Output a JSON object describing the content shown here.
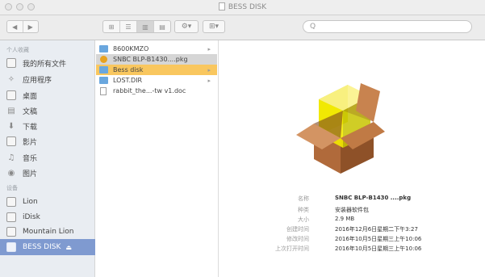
{
  "window": {
    "title": "BESS DISK"
  },
  "search": {
    "placeholder": "Q"
  },
  "toolbar": {
    "back": "◀",
    "forward": "▶",
    "view_icon": "⊞",
    "list_icon": "☰",
    "column_icon": "▥",
    "coverflow_icon": "▤",
    "action_icon": "⚙▾",
    "arrange_icon": "⊞▾"
  },
  "sidebar": {
    "favorites_header": "个人收藏",
    "favorites": [
      {
        "label": "我的所有文件",
        "icon": "all-files-icon"
      },
      {
        "label": "应用程序",
        "icon": "applications-icon"
      },
      {
        "label": "桌面",
        "icon": "desktop-icon"
      },
      {
        "label": "文稿",
        "icon": "documents-icon"
      },
      {
        "label": "下载",
        "icon": "downloads-icon"
      },
      {
        "label": "影片",
        "icon": "movies-icon"
      },
      {
        "label": "音乐",
        "icon": "music-icon"
      },
      {
        "label": "图片",
        "icon": "pictures-icon"
      }
    ],
    "devices_header": "设备",
    "devices": [
      {
        "label": "Lion",
        "icon": "disk-icon"
      },
      {
        "label": "iDisk",
        "icon": "disk-icon"
      },
      {
        "label": "Mountain Lion",
        "icon": "disk-icon"
      },
      {
        "label": "BESS DISK",
        "icon": "disk-icon",
        "selected": true
      }
    ],
    "eject": "⏏"
  },
  "files": [
    {
      "name": "8600KMZO",
      "type": "folder",
      "arrow": "▸"
    },
    {
      "name": "SNBC BLP-B1430....pkg",
      "type": "package"
    },
    {
      "name": "Bess disk",
      "type": "folder",
      "arrow": "▸"
    },
    {
      "name": "LOST.DIR",
      "type": "folder",
      "arrow": "▸"
    },
    {
      "name": "rabbit_the...-tw v1.doc",
      "type": "document"
    }
  ],
  "info": [
    {
      "label": "名称",
      "value": "SNBC BLP-B1430 ....pkg"
    },
    {
      "label": "种类",
      "value": "安装器软件包"
    },
    {
      "label": "大小",
      "value": "2.9 MB"
    },
    {
      "label": "创建时间",
      "value": "2016年12月6日星期二下午3:27"
    },
    {
      "label": "修改时间",
      "value": "2016年10月5日星期三上午10:06"
    },
    {
      "label": "上次打开时间",
      "value": "2016年10月5日星期三上午10:06"
    }
  ],
  "colors": {
    "sidebar_bg": "#e9edf2",
    "selected_sidebar": "#7f9ad0",
    "selected_file": "#f9c75f",
    "folder": "#6aa7de"
  }
}
